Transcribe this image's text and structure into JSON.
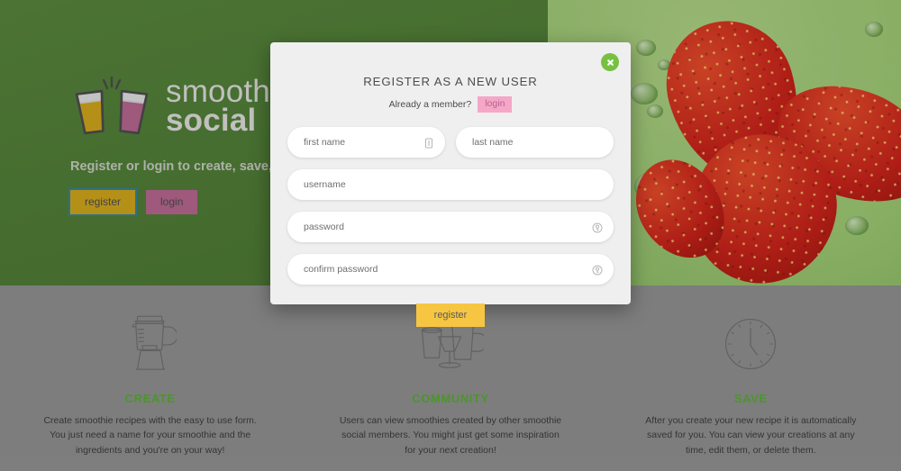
{
  "hero": {
    "brand_top": "smoothie",
    "brand_bottom": "social",
    "tagline": "Register or login to create, save, and share smoothie recipes",
    "register_label": "register",
    "login_label": "login",
    "logo_icon": "two-clinking-glasses-icon"
  },
  "modal": {
    "title": "REGISTER AS A NEW USER",
    "already_member_text": "Already a member?",
    "login_link_label": "login",
    "close_icon": "close-icon",
    "fields": {
      "first_name_placeholder": "first name",
      "first_name_value": "",
      "last_name_placeholder": "last name",
      "last_name_value": "",
      "username_placeholder": "username",
      "username_value": "",
      "password_placeholder": "password",
      "password_value": "",
      "confirm_password_placeholder": "confirm password",
      "confirm_password_value": ""
    },
    "submit_label": "register"
  },
  "features": [
    {
      "icon": "blender-icon",
      "title": "CREATE",
      "text": "Create smoothie recipes with the easy to use form. You just need a name for your smoothie and the ingredients and you're on your way!"
    },
    {
      "icon": "glasses-group-icon",
      "title": "COMMUNITY",
      "text": "Users can view smoothies created by other smoothie social members. You might just get some inspiration for your next creation!"
    },
    {
      "icon": "clock-icon",
      "title": "SAVE",
      "text": "After you create your new recipe it is automatically saved for you. You can view your creations at any time, edit them, or delete them."
    }
  ],
  "colors": {
    "hero_green": "#4e7a35",
    "footer_gray": "#8c8c8c",
    "accent_green": "#55a630",
    "yellow": "#caa11c",
    "pink": "#b0648c",
    "submit_yellow": "#f6c643",
    "close_green": "#77c043",
    "link_pink_bg": "#f6a7c8"
  }
}
